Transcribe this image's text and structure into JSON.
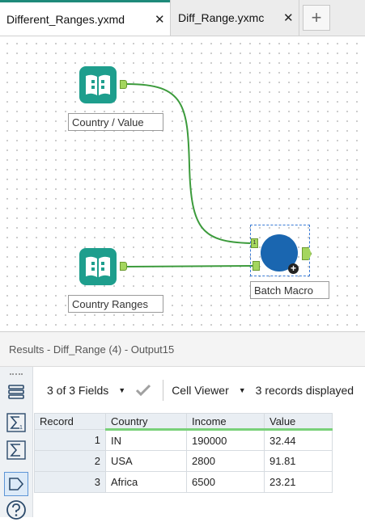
{
  "tabs": [
    {
      "label": "Different_Ranges.yxmd",
      "close": "✕",
      "active": true
    },
    {
      "label": "Diff_Range.yxmc",
      "close": "✕",
      "active": false
    }
  ],
  "add_tab": "+",
  "canvas": {
    "tools": [
      {
        "label": "Country / Value",
        "icon": "text-input-book-icon"
      },
      {
        "label": "Country Ranges",
        "icon": "text-input-book-icon"
      }
    ],
    "macro": {
      "label": "Batch Macro",
      "input_1": "1",
      "plus": "+"
    }
  },
  "results": {
    "title": "Results - Diff_Range (4) - Output15",
    "fields_label": "3 of 3 Fields",
    "cell_viewer_label": "Cell Viewer",
    "records_label": "3 records displayed",
    "columns": [
      "Record",
      "Country",
      "Income",
      "Value"
    ],
    "rows": [
      [
        "1",
        "IN",
        "190000",
        "32.44"
      ],
      [
        "2",
        "USA",
        "2800",
        "91.81"
      ],
      [
        "3",
        "Africa",
        "6500",
        "23.21"
      ]
    ]
  },
  "colors": {
    "accent": "#1e9e8d",
    "macro": "#1a66b0",
    "connector": "#3c9b3c",
    "anchor": "#a4d65e",
    "selection": "#3a7bd5"
  }
}
